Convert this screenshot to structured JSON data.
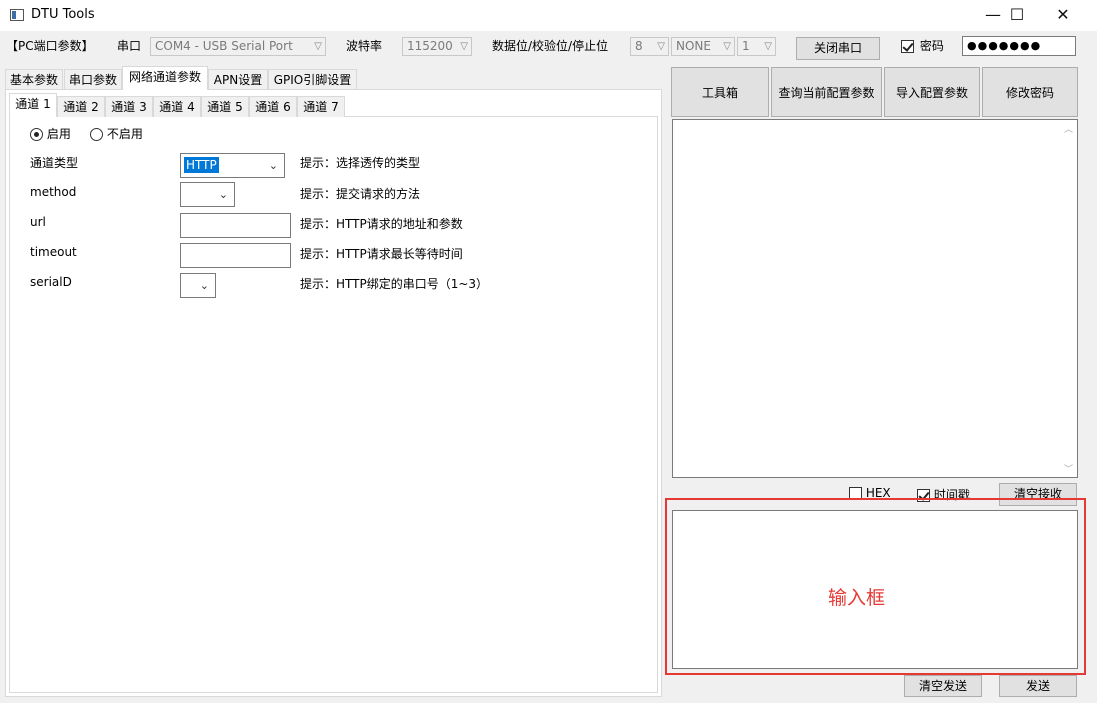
{
  "window": {
    "title": "DTU Tools",
    "minimize": "—",
    "maximize": "☐",
    "close": "✕"
  },
  "toolbar": {
    "pc_params": "【PC端口参数】",
    "port_label": "串口",
    "port_value": "COM4 - USB Serial Port",
    "baud_label": "波特率",
    "baud_value": "115200",
    "dps_label": "数据位/校验位/停止位",
    "data_bits": "8",
    "parity": "NONE",
    "stop_bits": "1",
    "close_port_label": "关闭串口",
    "password_label": "密码",
    "password_value": "●●●●●●●"
  },
  "main_tabs": [
    "基本参数",
    "串口参数",
    "网络通道参数",
    "APN设置",
    "GPIO引脚设置"
  ],
  "channel_tabs": [
    "通道 1",
    "通道 2",
    "通道 3",
    "通道 4",
    "通道 5",
    "通道 6",
    "通道 7"
  ],
  "channel_form": {
    "enable_label": "启用",
    "disable_label": "不启用",
    "type_label": "通道类型",
    "type_value": "HTTP",
    "type_hint": "提示：选择透传的类型",
    "method_label": "method",
    "method_hint": "提示：提交请求的方法",
    "url_label": "url",
    "url_hint": "提示：HTTP请求的地址和参数",
    "timeout_label": "timeout",
    "timeout_hint": "提示：HTTP请求最长等待时间",
    "serial_label": "serialD",
    "serial_hint": "提示：HTTP绑定的串口号（1~3）"
  },
  "right_panel": {
    "toolbox_label": "工具箱",
    "query_label": "查询当前配置参数",
    "import_label": "导入配置参数",
    "change_pwd_label": "修改密码",
    "hex_label": "HEX",
    "timestamp_label": "时间戳",
    "clear_recv_label": "清空接收",
    "input_annotation": "输入框",
    "clear_send_label": "清空发送",
    "send_label": "发送"
  }
}
